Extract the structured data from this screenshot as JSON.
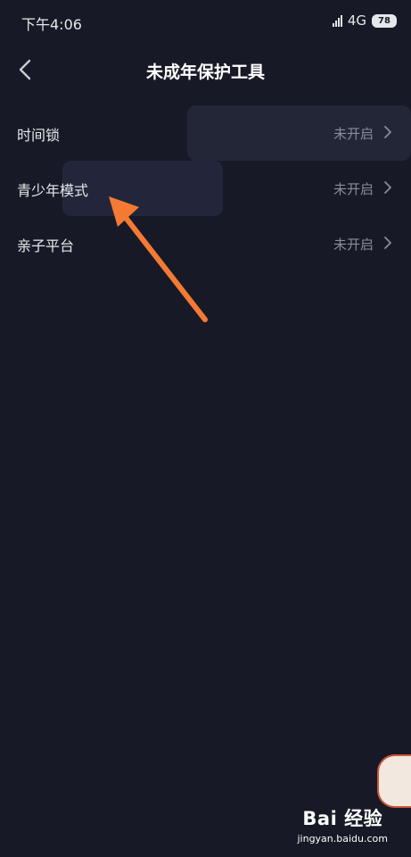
{
  "status_bar": {
    "time": "下午4:06",
    "network": "4G",
    "battery": "78"
  },
  "nav": {
    "title": "未成年保护工具"
  },
  "items": [
    {
      "label": "时间锁",
      "status": "未开启"
    },
    {
      "label": "青少年模式",
      "status": "未开启"
    },
    {
      "label": "亲子平台",
      "status": "未开启"
    }
  ],
  "watermark": {
    "logo": "Bai 经验",
    "url": "jingyan.baidu.com"
  },
  "colors": {
    "background": "#171a26",
    "arrow": "#f47a34"
  }
}
